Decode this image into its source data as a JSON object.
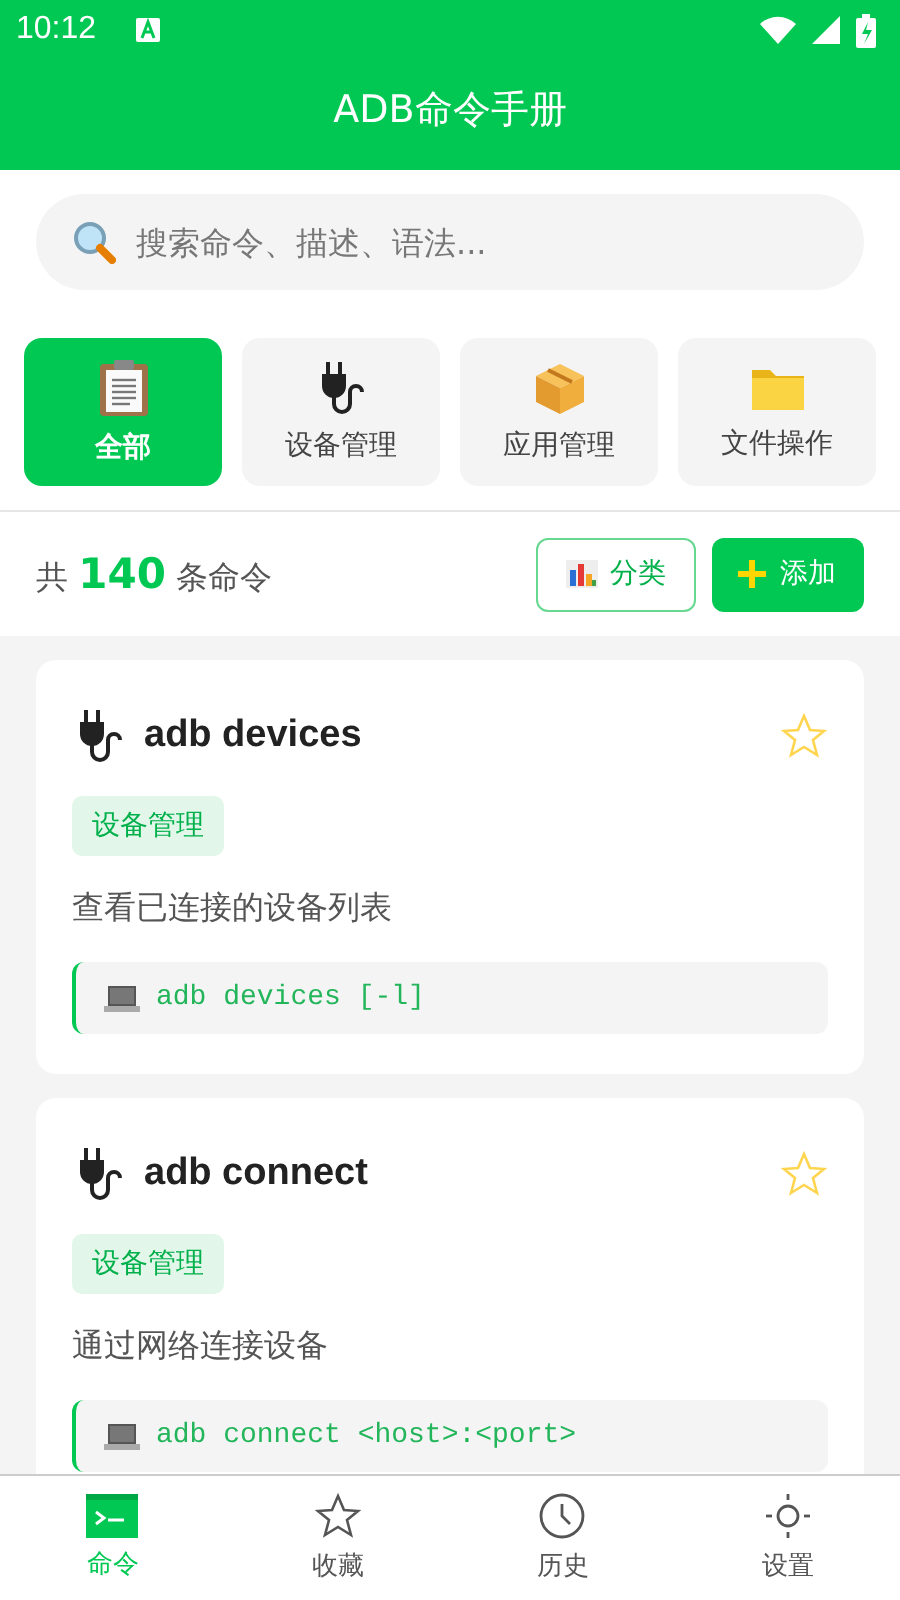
{
  "status_bar": {
    "time": "10:12"
  },
  "app_bar": {
    "title": "ADB命令手册"
  },
  "search": {
    "placeholder": "搜索命令、描述、语法..."
  },
  "categories": [
    {
      "label": "全部",
      "kind": "clipboard",
      "selected": true
    },
    {
      "label": "设备管理",
      "kind": "plug",
      "selected": false
    },
    {
      "label": "应用管理",
      "kind": "box",
      "selected": false
    },
    {
      "label": "文件操作",
      "kind": "folder",
      "selected": false
    }
  ],
  "summary": {
    "prefix": "共",
    "count": "140",
    "suffix": "条命令"
  },
  "actions": [
    {
      "label": "分类",
      "kind": "outline"
    },
    {
      "label": "添加",
      "kind": "filled"
    }
  ],
  "commands": [
    {
      "title": "adb devices",
      "tag": "设备管理",
      "description": "查看已连接的设备列表",
      "syntax": "adb devices [-l]",
      "favorite": false
    },
    {
      "title": "adb connect",
      "tag": "设备管理",
      "description": "通过网络连接设备",
      "syntax": "adb connect <host>:<port>",
      "favorite": false
    }
  ],
  "bottom_nav": [
    {
      "label": "命令",
      "kind": "terminal",
      "selected": true
    },
    {
      "label": "收藏",
      "kind": "star",
      "selected": false
    },
    {
      "label": "历史",
      "kind": "clock",
      "selected": false
    },
    {
      "label": "设置",
      "kind": "sun",
      "selected": false
    }
  ]
}
